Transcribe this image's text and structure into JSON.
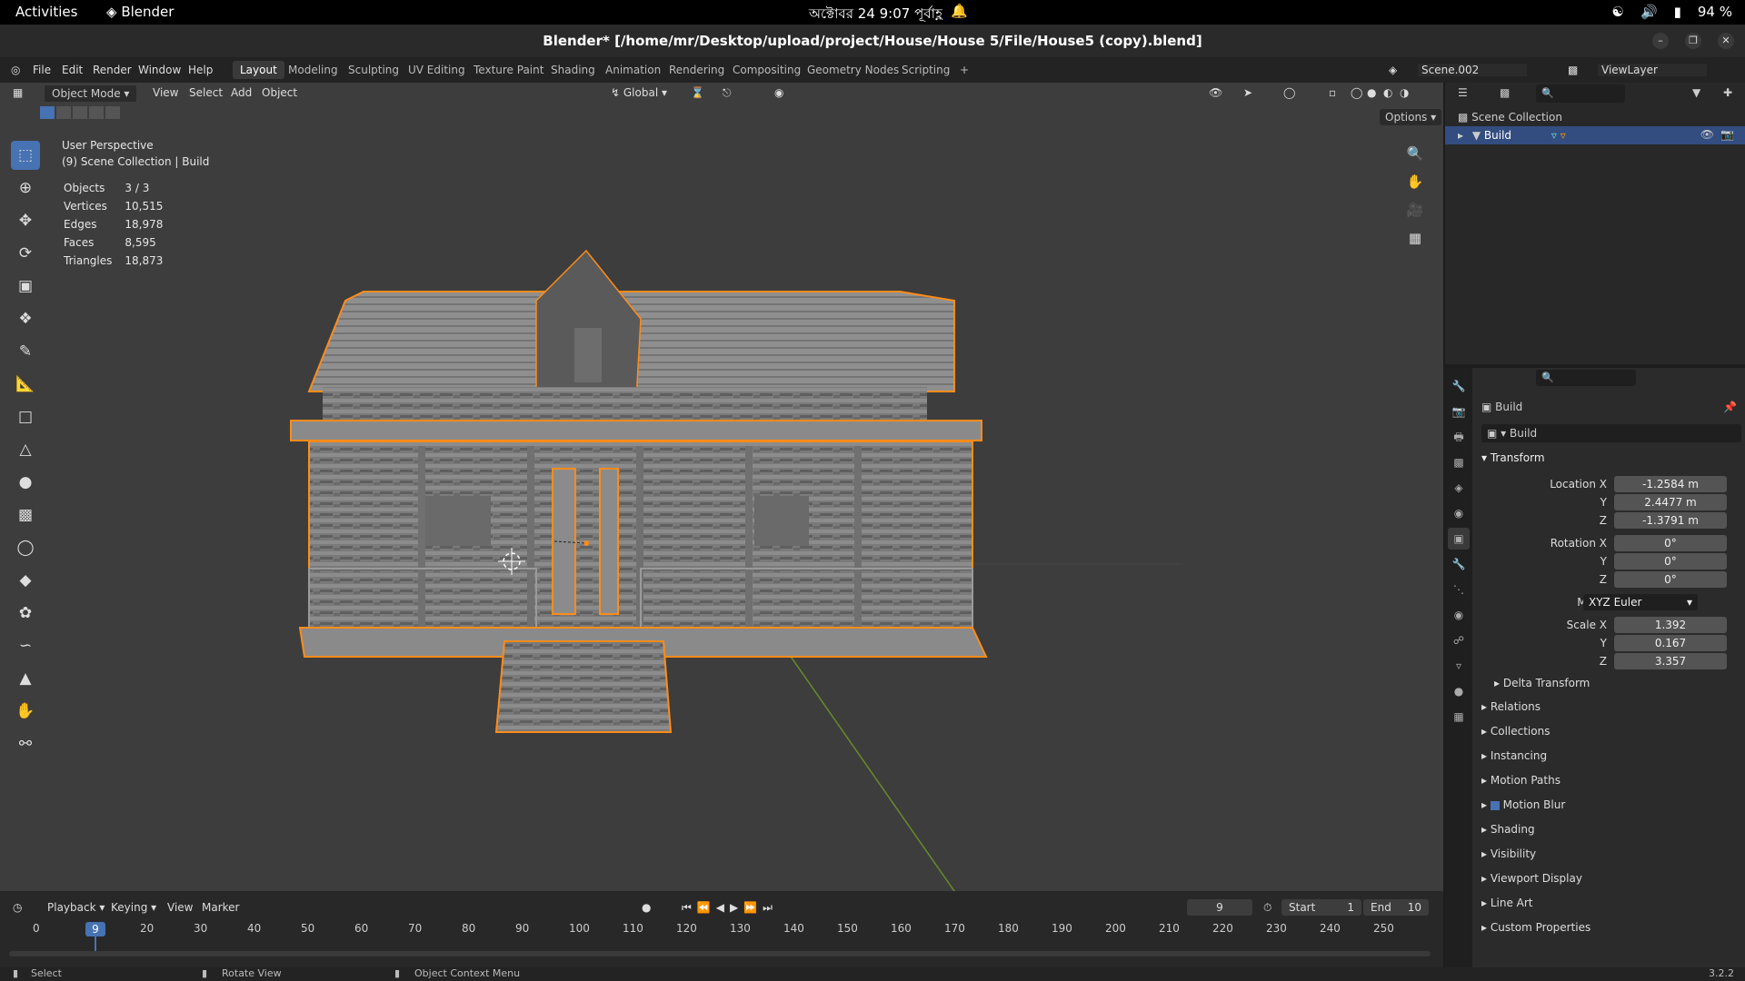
{
  "gnome": {
    "activities": "Activities",
    "app": "Blender",
    "clock": "অক্টোবর 24  9:07 পূর্বাহ্ণ",
    "battery": "94 %"
  },
  "window": {
    "title": "Blender* [/home/mr/Desktop/upload/project/House/House 5/File/House5 (copy).blend]"
  },
  "menu": {
    "items": [
      "File",
      "Edit",
      "Render",
      "Window",
      "Help"
    ],
    "workspaces": [
      "Layout",
      "Modeling",
      "Sculpting",
      "UV Editing",
      "Texture Paint",
      "Shading",
      "Animation",
      "Rendering",
      "Compositing",
      "Geometry Nodes",
      "Scripting"
    ],
    "active_workspace": "Layout",
    "scene": "Scene.002",
    "view_layer": "ViewLayer"
  },
  "viewport": {
    "mode": "Object Mode",
    "menus": [
      "View",
      "Select",
      "Add",
      "Object"
    ],
    "orientation": "Global",
    "options": "Options",
    "perspective": "User Perspective",
    "collection": "(9) Scene Collection | Build",
    "stats": [
      {
        "label": "Objects",
        "value": "3 / 3"
      },
      {
        "label": "Vertices",
        "value": "10,515"
      },
      {
        "label": "Edges",
        "value": "18,978"
      },
      {
        "label": "Faces",
        "value": "8,595"
      },
      {
        "label": "Triangles",
        "value": "18,873"
      }
    ]
  },
  "timeline": {
    "menus": [
      "Playback",
      "Keying",
      "View",
      "Marker"
    ],
    "current_frame": "9",
    "start_label": "Start",
    "start": "1",
    "end_label": "End",
    "end": "10",
    "ticks": [
      "0",
      "10",
      "20",
      "30",
      "40",
      "50",
      "60",
      "70",
      "80",
      "90",
      "100",
      "110",
      "120",
      "130",
      "140",
      "150",
      "160",
      "170",
      "180",
      "190",
      "200",
      "210",
      "220",
      "230",
      "240",
      "250"
    ],
    "marker": "9"
  },
  "status": {
    "select": "Select",
    "rotate": "Rotate View",
    "context": "Object Context Menu",
    "version": "3.2.2"
  },
  "outliner": {
    "root": "Scene Collection",
    "item": "Build"
  },
  "properties": {
    "object_name": "Build",
    "data_name": "Build",
    "transform_label": "Transform",
    "location": {
      "label": "Location X",
      "x": "-1.2584 m",
      "y": "2.4477 m",
      "z": "-1.3791 m"
    },
    "rotation": {
      "label": "Rotation X",
      "x": "0°",
      "y": "0°",
      "z": "0°"
    },
    "mode_label": "Mode",
    "mode_value": "XYZ Euler",
    "scale": {
      "label": "Scale X",
      "x": "1.392",
      "y": "0.167",
      "z": "3.357"
    },
    "axis_y": "Y",
    "axis_z": "Z",
    "panels": [
      "Delta Transform",
      "Relations",
      "Collections",
      "Instancing",
      "Motion Paths",
      "Motion Blur",
      "Shading",
      "Visibility",
      "Viewport Display",
      "Line Art",
      "Custom Properties"
    ]
  }
}
